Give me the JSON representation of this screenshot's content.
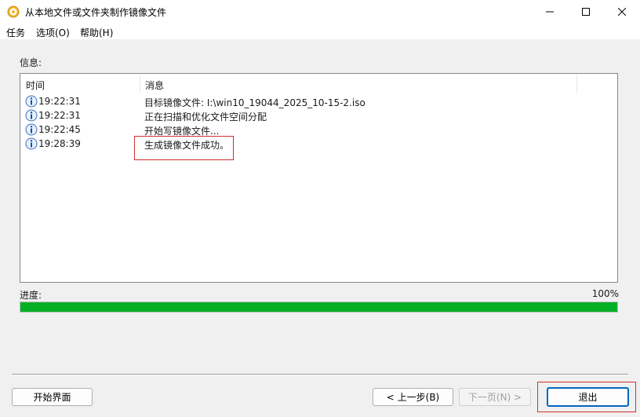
{
  "window": {
    "title": "从本地文件或文件夹制作镜像文件"
  },
  "menu": {
    "items": [
      "任务",
      "选项(O)",
      "帮助(H)"
    ]
  },
  "info": {
    "label": "信息:",
    "columns": [
      "时间",
      "消息"
    ],
    "rows": [
      {
        "time": "19:22:31",
        "message": "目标镜像文件: I:\\win10_19044_2025_10-15-2.iso",
        "icon": "info-icon"
      },
      {
        "time": "19:22:31",
        "message": "正在扫描和优化文件空间分配",
        "icon": "info-icon"
      },
      {
        "time": "19:22:45",
        "message": "开始写镜像文件...",
        "icon": "info-icon"
      },
      {
        "time": "19:28:39",
        "message": "生成镜像文件成功。",
        "icon": "info-icon"
      }
    ]
  },
  "progress": {
    "label": "进度:",
    "percent_text": "100%",
    "fraction": 1.0
  },
  "buttons": {
    "home": "开始界面",
    "prev": "< 上一步(B)",
    "next": "下一页(N) >",
    "exit": "退出"
  },
  "colors": {
    "progress_fill": "#06b025",
    "highlight": "#d32f2f"
  }
}
